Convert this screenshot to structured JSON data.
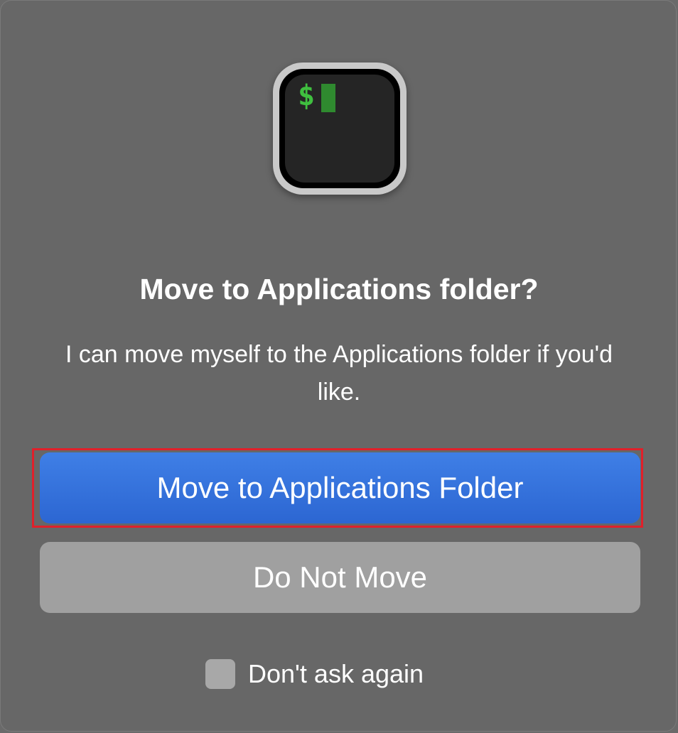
{
  "dialog": {
    "icon": "terminal-app-icon",
    "icon_prompt": "$",
    "title": "Move to Applications folder?",
    "message": "I can move myself to the Applications folder if you'd like.",
    "primary_button": "Move to Applications Folder",
    "secondary_button": "Do Not Move",
    "checkbox_label": "Don't ask again",
    "checkbox_checked": false
  },
  "colors": {
    "background": "#676767",
    "primary_button": "#3574de",
    "secondary_button": "#a0a0a0",
    "highlight_border": "#e0202a",
    "terminal_prompt": "#3fbf3f"
  }
}
